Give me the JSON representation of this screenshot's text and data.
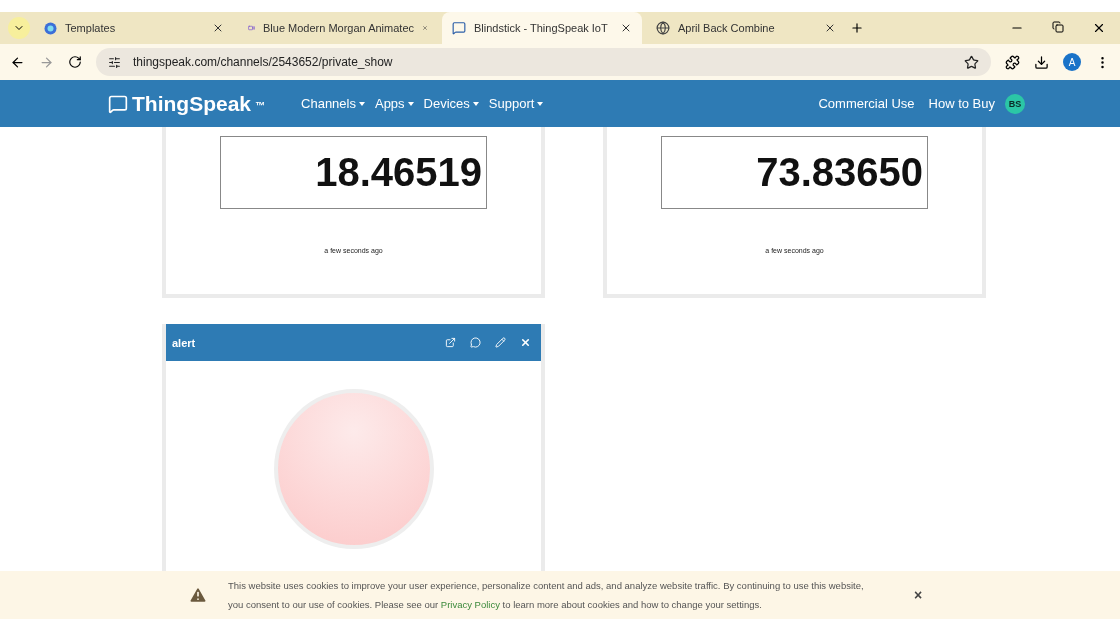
{
  "browser": {
    "tabs": [
      {
        "title": "Templates",
        "kind": "canva",
        "selected": false
      },
      {
        "title": "Blue Modern Morgan Animatec",
        "kind": "video",
        "selected": false
      },
      {
        "title": "Blindstick - ThingSpeak IoT",
        "kind": "page",
        "selected": true
      },
      {
        "title": "April Back Combine",
        "kind": "globe",
        "selected": false
      }
    ],
    "address": "thingspeak.com/channels/2543652/private_show",
    "profile": "A"
  },
  "nav": {
    "brand": "ThingSpeak",
    "trademark": "™",
    "menus": [
      "Channels",
      "Apps",
      "Devices",
      "Support"
    ],
    "links": [
      "Commercial Use",
      "How to Buy"
    ],
    "avatar": "BS"
  },
  "widgets": [
    {
      "kind": "numeric",
      "value": "18.46519",
      "timestamp": "a few seconds ago"
    },
    {
      "kind": "numeric",
      "value": "73.83650",
      "timestamp": "a few seconds ago"
    },
    {
      "kind": "lamp",
      "title": "alert",
      "on": false
    }
  ],
  "cookie_banner": {
    "before": "This website uses cookies to improve your user experience, personalize content and ads, and analyze website traffic. By continuing to use this website, you consent to our use of cookies. Please see our",
    "link": "Privacy Policy",
    "after": "to learn more about cookies and how to change your settings.",
    "close": "×"
  }
}
